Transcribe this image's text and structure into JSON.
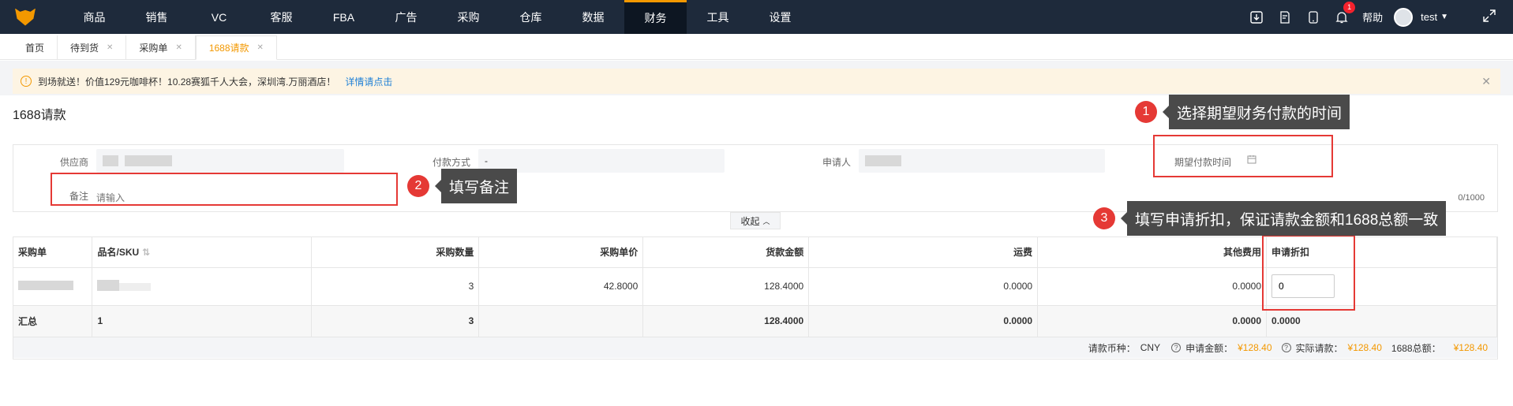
{
  "nav": {
    "items": [
      "商品",
      "销售",
      "VC",
      "客服",
      "FBA",
      "广告",
      "采购",
      "仓库",
      "数据",
      "财务",
      "工具",
      "设置"
    ],
    "active": "财务",
    "badge_count": "1",
    "help": "帮助",
    "user": "test"
  },
  "tabs": [
    {
      "label": "首页"
    },
    {
      "label": "待到货"
    },
    {
      "label": "采购单"
    },
    {
      "label": "1688请款"
    }
  ],
  "notice": {
    "text": "到场就送！价值129元咖啡杯！10.28赛狐千人大会，深圳湾.万丽酒店！",
    "link": "详情请点击"
  },
  "page_title": "1688请款",
  "form": {
    "supplier_label": "供应商",
    "payment_method_label": "付款方式",
    "payment_method_value": "-",
    "applicant_label": "申请人",
    "expected_time_label": "期望付款时间",
    "remark_label": "备注",
    "remark_placeholder": "请输入",
    "counter": "0/1000"
  },
  "collapse_label": "收起",
  "table": {
    "headers": [
      "采购单",
      "品名/SKU",
      "采购数量",
      "采购单价",
      "货款金额",
      "运费",
      "其他费用",
      "申请折扣"
    ],
    "row": {
      "qty": "3",
      "unit_price": "42.8000",
      "amount": "128.4000",
      "freight": "0.0000",
      "other": "0.0000",
      "discount": "0"
    },
    "summary": {
      "label": "汇总",
      "sku_count": "1",
      "qty": "3",
      "amount": "128.4000",
      "freight": "0.0000",
      "other": "0.0000",
      "discount": "0.0000"
    }
  },
  "footer": {
    "currency_label": "请款币种：",
    "currency": "CNY",
    "apply_amount_label": "申请金额：",
    "apply_amount": "¥128.40",
    "actual_label": "实际请款：",
    "actual_amount": "¥128.40",
    "total_1688_label": "1688总额：",
    "total_1688": "¥128.40"
  },
  "annotations": [
    {
      "num": "1",
      "text": "选择期望财务付款的时间"
    },
    {
      "num": "2",
      "text": "填写备注"
    },
    {
      "num": "3",
      "text": "填写申请折扣，保证请款金额和1688总额一致"
    }
  ],
  "colors": {
    "accent": "#f39800",
    "topbar": "#1e2a3b",
    "annotation": "#e53935"
  }
}
